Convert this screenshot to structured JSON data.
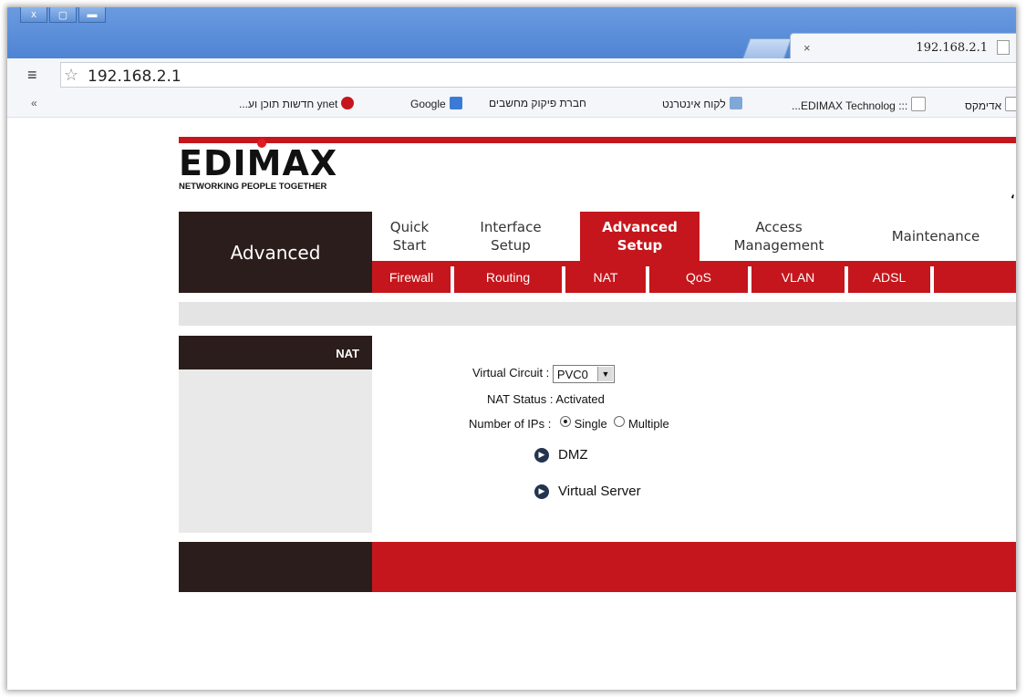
{
  "window": {
    "controls": [
      "x",
      "▢",
      "▬"
    ]
  },
  "tab": {
    "close": "×",
    "title": "192.168.2.1"
  },
  "address_bar": {
    "url": "192.168.2.1"
  },
  "bookmarks": [
    {
      "label": "אדימקס",
      "icon": "page-icon"
    },
    {
      "label": "::: EDIMAX Technolog...",
      "icon": "page-icon"
    },
    {
      "label": "לקוח אינטרנט",
      "icon": "map-icon"
    },
    {
      "label": "חברת פיקוק מחשבים",
      "icon": ""
    },
    {
      "label": "Google",
      "icon": "google-icon"
    },
    {
      "label": "ynet חדשות תוכן וע...",
      "icon": "ynet-icon"
    }
  ],
  "router": {
    "logo": "EDIMAX",
    "tagline": "NETWORKING PEOPLE TOGETHER",
    "section": "Advanced",
    "nav": [
      {
        "line1": "Quick",
        "line2": "Start"
      },
      {
        "line1": "Interface",
        "line2": "Setup"
      },
      {
        "line1": "Advanced",
        "line2": "Setup"
      },
      {
        "line1": "Access",
        "line2": "Management"
      },
      {
        "line1": "Maintenance",
        "line2": ""
      }
    ],
    "subnav": [
      "Firewall",
      "Routing",
      "NAT",
      "QoS",
      "VLAN",
      "ADSL"
    ],
    "page_title": "NAT",
    "form": {
      "virtual_circuit_label": "Virtual Circuit :",
      "virtual_circuit_value": "PVC0",
      "nat_status_label": "NAT Status :",
      "nat_status_value": "Activated",
      "num_ips_label": "Number of IPs :",
      "option_single": "Single",
      "option_multiple": "Multiple",
      "selected": "Single"
    },
    "links": [
      "DMZ",
      "Virtual Server"
    ]
  },
  "colors": {
    "brand_red": "#c4161c",
    "dark": "#2b1d1b",
    "chrome_blue": "#4f84d4"
  }
}
